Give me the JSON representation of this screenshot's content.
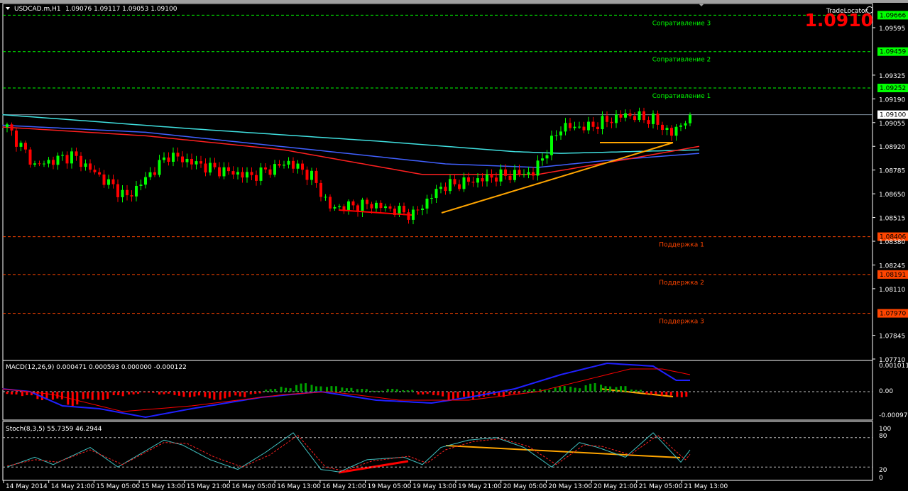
{
  "header": {
    "symbol": "USDCAD.m,H1",
    "ohlc": "1.09076 1.09117 1.09053 1.09100"
  },
  "trade_locator": {
    "label": "TradeLocator",
    "big_price": "1.0910"
  },
  "price_axis": {
    "ticks": [
      "1.09595",
      "1.09325",
      "1.09190",
      "1.09055",
      "1.08920",
      "1.08785",
      "1.08650",
      "1.08515",
      "1.08380",
      "1.08245",
      "1.08110",
      "1.07845",
      "1.07710"
    ],
    "current_price": "1.09100"
  },
  "levels": [
    {
      "label": "Сопративление 3",
      "price": "1.09666",
      "color": "#00ff00"
    },
    {
      "label": "Сопративление 2",
      "price": "1.09459",
      "color": "#00ff00"
    },
    {
      "label": "Сопративление 1",
      "price": "1.09252",
      "color": "#00ff00"
    },
    {
      "label": "Поддержка 1",
      "price": "1.08406",
      "color": "#ff4500"
    },
    {
      "label": "Поддержка 2",
      "price": "1.08191",
      "color": "#ff4500"
    },
    {
      "label": "Поддержка 3",
      "price": "1.07970",
      "color": "#ff4500"
    }
  ],
  "price_anchors": [
    [
      0,
      1.0903
    ],
    [
      6,
      1.0881
    ],
    [
      14,
      1.0887
    ],
    [
      26,
      1.0863
    ],
    [
      35,
      1.0887
    ],
    [
      45,
      1.0879
    ],
    [
      53,
      1.0875
    ],
    [
      61,
      1.0883
    ],
    [
      66,
      1.0875
    ],
    [
      70,
      1.0857
    ],
    [
      79,
      1.0859
    ],
    [
      88,
      1.0853
    ],
    [
      94,
      1.0869
    ],
    [
      106,
      1.0875
    ],
    [
      114,
      1.0877
    ],
    [
      120,
      1.0903
    ],
    [
      126,
      1.0903
    ],
    [
      134,
      1.091
    ],
    [
      140,
      1.0907
    ],
    [
      144,
      1.0899
    ],
    [
      148,
      1.091
    ]
  ],
  "ma_cyan": [
    [
      -1,
      1.091
    ],
    [
      40,
      1.0902
    ],
    [
      80,
      1.0895
    ],
    [
      110,
      1.0889
    ],
    [
      120,
      1.0888
    ],
    [
      150,
      1.089
    ]
  ],
  "ma_blue": [
    [
      -1,
      1.0904
    ],
    [
      30,
      1.09
    ],
    [
      70,
      1.0889
    ],
    [
      95,
      1.0882
    ],
    [
      115,
      1.088
    ],
    [
      130,
      1.0884
    ],
    [
      150,
      1.0888
    ]
  ],
  "ma_red": [
    [
      -1,
      1.0903
    ],
    [
      30,
      1.0898
    ],
    [
      60,
      1.089
    ],
    [
      90,
      1.0876
    ],
    [
      115,
      1.0876
    ],
    [
      135,
      1.0885
    ],
    [
      150,
      1.0892
    ]
  ],
  "macd": {
    "label": "MACD(12,26,9) 0.000471 0.000593 0.000000 -0.000122",
    "ticks": [
      "0.001011",
      "0.00",
      "-0.00097"
    ],
    "hist": [
      -0.0001,
      -0.0002,
      -0.0003,
      -0.0004,
      -0.0005,
      -0.0004,
      -0.0003,
      -0.0002,
      -0.0001,
      -5e-05,
      -0.0001,
      -0.0002,
      -0.0002,
      -0.0003,
      -0.0003,
      -0.0002,
      -0.0001,
      0.0001,
      0.0002,
      0.0003,
      0.0003,
      0.0002,
      0.0002,
      0.0001,
      5e-05,
      0.0001,
      8e-05,
      -0.0001,
      -0.0002,
      -0.0003,
      -0.0003,
      -0.0002,
      -0.0002,
      -0.0001,
      0.0001,
      0.0001,
      0.0002,
      0.0002,
      0.0003,
      0.0003,
      0.0002,
      0.0001,
      -0.0001,
      -0.0002,
      -0.0002
    ],
    "main": [
      [
        -1,
        0.0001
      ],
      [
        5,
        0.0
      ],
      [
        12,
        -0.0005
      ],
      [
        20,
        -0.0006
      ],
      [
        30,
        -0.0009
      ],
      [
        40,
        -0.0006
      ],
      [
        55,
        -0.0002
      ],
      [
        68,
        0.0
      ],
      [
        80,
        -0.0003
      ],
      [
        92,
        -0.0004
      ],
      [
        100,
        -0.0002
      ],
      [
        110,
        0.0001
      ],
      [
        120,
        0.0006
      ],
      [
        130,
        0.001
      ],
      [
        140,
        0.0009
      ],
      [
        145,
        0.0004
      ],
      [
        148,
        0.0004
      ]
    ],
    "signal": [
      [
        -1,
        0.0001
      ],
      [
        10,
        -0.0001
      ],
      [
        25,
        -0.0007
      ],
      [
        40,
        -0.0005
      ],
      [
        60,
        -0.0001
      ],
      [
        70,
        0.0
      ],
      [
        85,
        -0.0003
      ],
      [
        100,
        -0.0003
      ],
      [
        115,
        0.0
      ],
      [
        125,
        0.0004
      ],
      [
        135,
        0.0008
      ],
      [
        142,
        0.0008
      ],
      [
        148,
        0.0006
      ]
    ]
  },
  "stoch": {
    "label": "Stoch(8,3,5) 55.7359 46.2944",
    "ticks": [
      "100",
      "80",
      "20",
      "0"
    ],
    "main": [
      [
        0,
        20
      ],
      [
        6,
        40
      ],
      [
        10,
        25
      ],
      [
        18,
        60
      ],
      [
        24,
        20
      ],
      [
        34,
        75
      ],
      [
        38,
        65
      ],
      [
        44,
        35
      ],
      [
        50,
        15
      ],
      [
        56,
        50
      ],
      [
        62,
        90
      ],
      [
        68,
        15
      ],
      [
        72,
        10
      ],
      [
        78,
        35
      ],
      [
        86,
        40
      ],
      [
        90,
        25
      ],
      [
        94,
        60
      ],
      [
        100,
        75
      ],
      [
        106,
        80
      ],
      [
        112,
        60
      ],
      [
        118,
        20
      ],
      [
        124,
        70
      ],
      [
        128,
        60
      ],
      [
        134,
        40
      ],
      [
        140,
        90
      ],
      [
        146,
        30
      ],
      [
        148,
        55
      ]
    ],
    "signal": [
      [
        0,
        22
      ],
      [
        6,
        35
      ],
      [
        11,
        30
      ],
      [
        18,
        55
      ],
      [
        25,
        25
      ],
      [
        34,
        70
      ],
      [
        39,
        68
      ],
      [
        45,
        40
      ],
      [
        51,
        20
      ],
      [
        57,
        45
      ],
      [
        63,
        85
      ],
      [
        69,
        20
      ],
      [
        73,
        12
      ],
      [
        79,
        32
      ],
      [
        87,
        42
      ],
      [
        91,
        28
      ],
      [
        95,
        55
      ],
      [
        101,
        72
      ],
      [
        107,
        78
      ],
      [
        113,
        62
      ],
      [
        119,
        25
      ],
      [
        125,
        65
      ],
      [
        129,
        62
      ],
      [
        135,
        45
      ],
      [
        141,
        85
      ],
      [
        147,
        35
      ],
      [
        148,
        46
      ]
    ]
  },
  "time_axis": [
    "14 May 2014",
    "14 May 21:00",
    "15 May 05:00",
    "15 May 13:00",
    "15 May 21:00",
    "16 May 05:00",
    "16 May 13:00",
    "16 May 21:00",
    "19 May 05:00",
    "19 May 13:00",
    "19 May 21:00",
    "20 May 05:00",
    "20 May 13:00",
    "20 May 21:00",
    "21 May 05:00",
    "21 May 13:00"
  ],
  "colors": {
    "bull": "#00ff00",
    "bear": "#ff0000",
    "support": "#ff4500",
    "resistance": "#00ff00",
    "trend": "#ffa500"
  }
}
